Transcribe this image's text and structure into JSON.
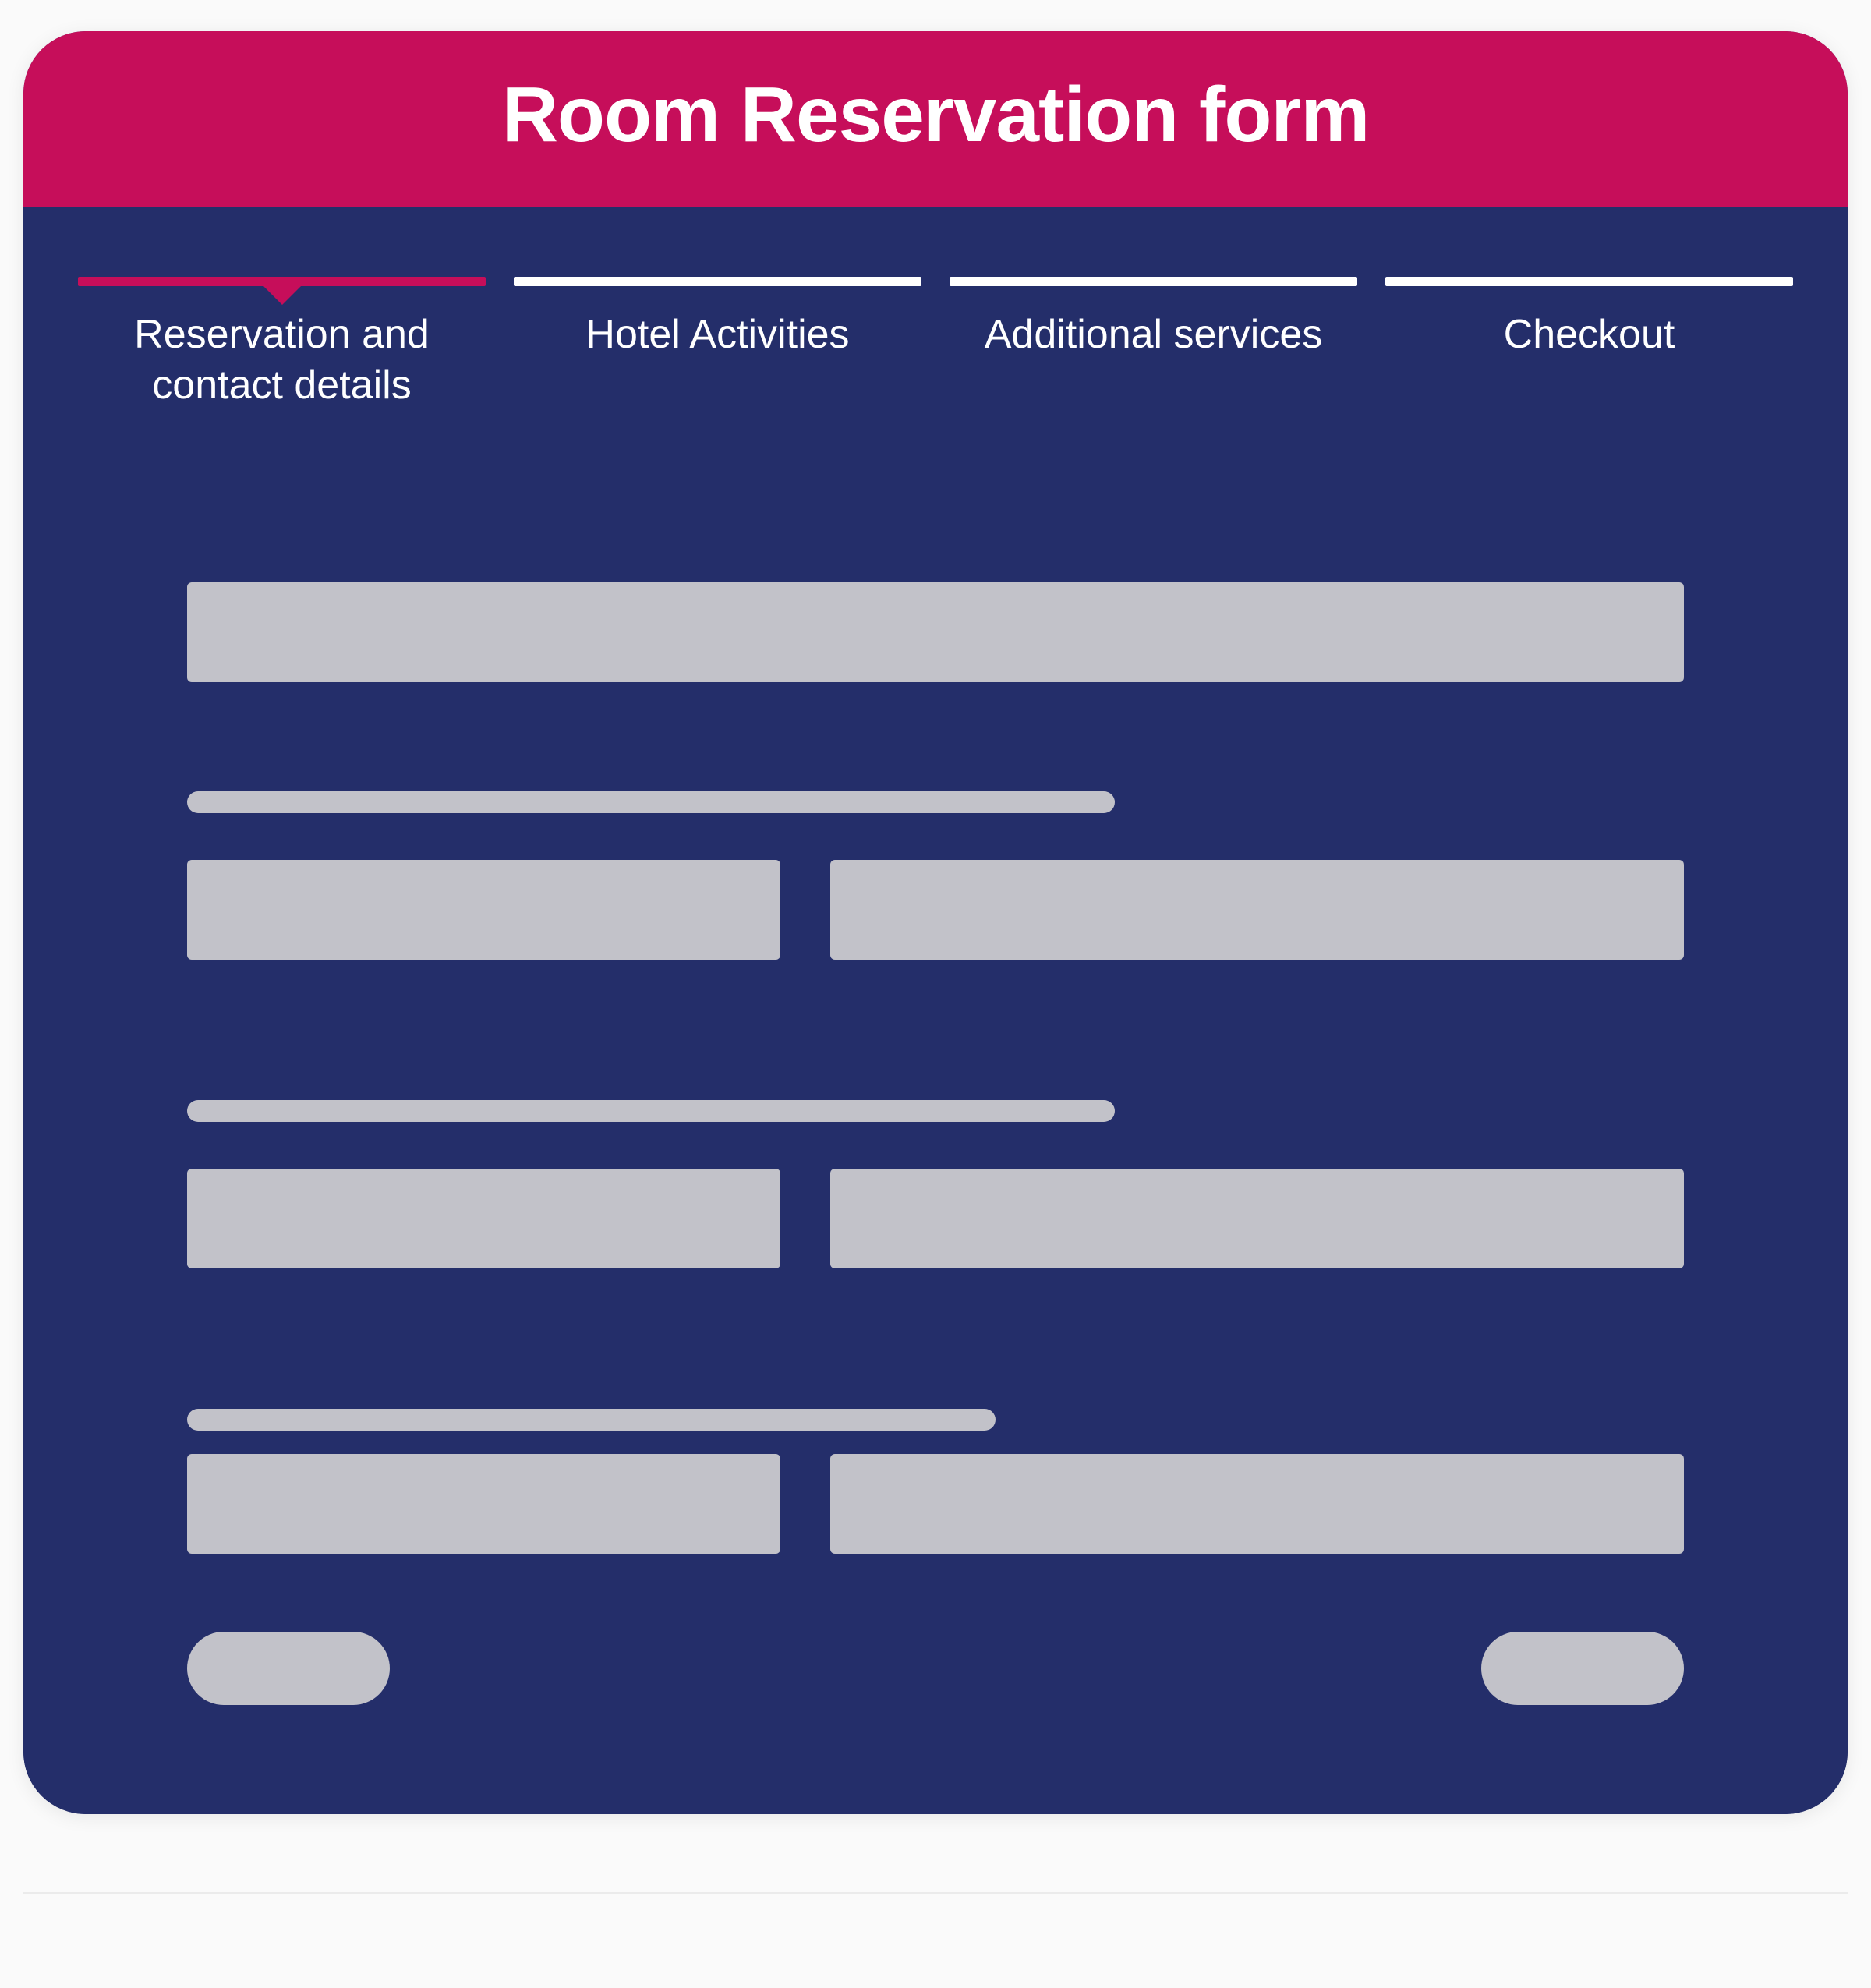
{
  "header": {
    "title": "Room Reservation form"
  },
  "steps": [
    {
      "label": "Reservation and contact details",
      "active": true
    },
    {
      "label": "Hotel Activities",
      "active": false
    },
    {
      "label": "Additional services",
      "active": false
    },
    {
      "label": "Checkout",
      "active": false
    }
  ],
  "colors": {
    "accent": "#c60e5a",
    "body": "#242e6a",
    "placeholder": "#c2c2c9"
  }
}
